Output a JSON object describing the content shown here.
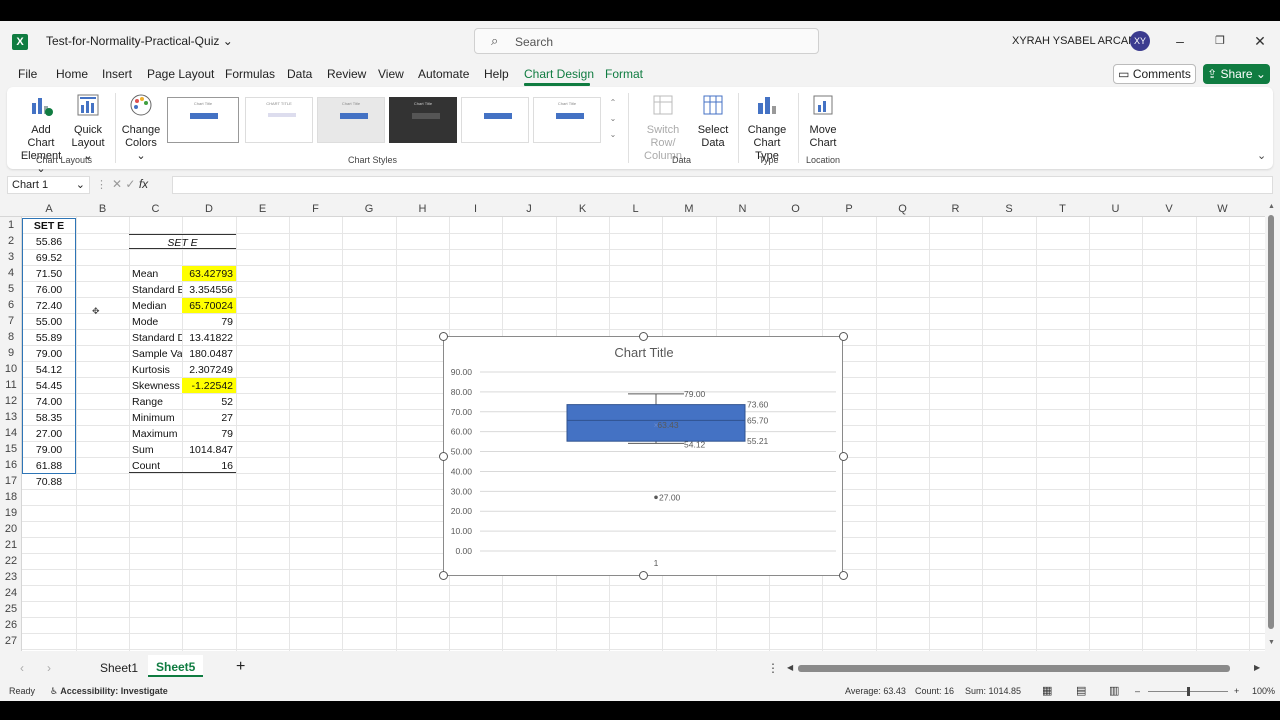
{
  "app": {
    "file_name": "Test-for-Normality-Practical-Quiz",
    "search_placeholder": "Search",
    "user_name": "XYRAH YSABEL ARCAMO",
    "user_initials": "XY"
  },
  "menu": {
    "items": [
      "File",
      "Home",
      "Insert",
      "Page Layout",
      "Formulas",
      "Data",
      "Review",
      "View",
      "Automate",
      "Help",
      "Chart Design",
      "Format"
    ],
    "active": "Chart Design",
    "comments": "Comments",
    "share": "Share"
  },
  "ribbon": {
    "add_chart_element": [
      "Add Chart",
      "Element"
    ],
    "quick_layout": [
      "Quick",
      "Layout"
    ],
    "change_colors": [
      "Change",
      "Colors"
    ],
    "switch_row_column": [
      "Switch Row/",
      "Column"
    ],
    "select_data": [
      "Select",
      "Data"
    ],
    "change_chart_type": [
      "Change",
      "Chart Type"
    ],
    "move_chart": [
      "Move",
      "Chart"
    ],
    "groups": {
      "chart_layouts": "Chart Layouts",
      "chart_styles": "Chart Styles",
      "data": "Data",
      "type": "Type",
      "location": "Location"
    },
    "style_thumb_titles": [
      "Chart Title",
      "CHART TITLE",
      "Chart Title",
      "Chart Title",
      "",
      "Chart Title"
    ]
  },
  "formula_bar": {
    "name_box": "Chart 1",
    "fx": "fx",
    "value": ""
  },
  "sheet": {
    "columns": [
      "A",
      "B",
      "C",
      "D",
      "E",
      "F",
      "G",
      "H",
      "I",
      "J",
      "K",
      "L",
      "M",
      "N",
      "O",
      "P",
      "Q",
      "R",
      "S",
      "T",
      "U",
      "V",
      "W"
    ],
    "rows": [
      "1",
      "2",
      "3",
      "4",
      "5",
      "6",
      "7",
      "8",
      "9",
      "10",
      "11",
      "12",
      "13",
      "14",
      "15",
      "16",
      "17",
      "18",
      "19",
      "20",
      "21",
      "22",
      "23",
      "24",
      "25",
      "26",
      "27"
    ],
    "col_a_header": "SET E",
    "col_a_values": [
      "55.86",
      "69.52",
      "71.50",
      "76.00",
      "72.40",
      "55.00",
      "55.89",
      "79.00",
      "54.12",
      "54.45",
      "74.00",
      "58.35",
      "27.00",
      "79.00",
      "61.88",
      "70.88"
    ],
    "stats_header": "SET E",
    "stats": [
      {
        "label": "Mean",
        "value": "63.42793",
        "highlight": true
      },
      {
        "label": "Standard E",
        "value": "3.354556",
        "highlight": false
      },
      {
        "label": "Median",
        "value": "65.70024",
        "highlight": true
      },
      {
        "label": "Mode",
        "value": "79",
        "highlight": false
      },
      {
        "label": "Standard D",
        "value": "13.41822",
        "highlight": false
      },
      {
        "label": "Sample Va",
        "value": "180.0487",
        "highlight": false
      },
      {
        "label": "Kurtosis",
        "value": "2.307249",
        "highlight": false
      },
      {
        "label": "Skewness",
        "value": "-1.22542",
        "highlight": true
      },
      {
        "label": "Range",
        "value": "52",
        "highlight": false
      },
      {
        "label": "Minimum",
        "value": "27",
        "highlight": false
      },
      {
        "label": "Maximum",
        "value": "79",
        "highlight": false
      },
      {
        "label": "Sum",
        "value": "1014.847",
        "highlight": false
      },
      {
        "label": "Count",
        "value": "16",
        "highlight": false
      }
    ],
    "highlight_color": "#ffff00"
  },
  "chart_data": {
    "type": "box",
    "title": "Chart Title",
    "ylim": [
      0,
      90
    ],
    "y_ticks": [
      "0.00",
      "10.00",
      "20.00",
      "30.00",
      "40.00",
      "50.00",
      "60.00",
      "70.00",
      "80.00",
      "90.00"
    ],
    "categories": [
      "1"
    ],
    "box": {
      "min": 54.12,
      "q1": 55.21,
      "median": 65.7,
      "mean": 63.43,
      "q3": 73.6,
      "max": 79.0,
      "outliers": [
        27.0
      ]
    },
    "labels": {
      "max": "79.00",
      "q3": "73.60",
      "median": "65.70",
      "mean": "63.43",
      "q1": "55.21",
      "min": "54.12",
      "outlier": "27.00"
    },
    "box_color": "#4472c4",
    "grid": true
  },
  "tabs": {
    "items": [
      "Sheet1",
      "Sheet5"
    ],
    "active": "Sheet5",
    "add": "+"
  },
  "status": {
    "ready": "Ready",
    "accessibility": "Accessibility: Investigate",
    "average": "Average: 63.43",
    "count": "Count: 16",
    "sum": "Sum: 1014.85",
    "zoom": "100%"
  }
}
